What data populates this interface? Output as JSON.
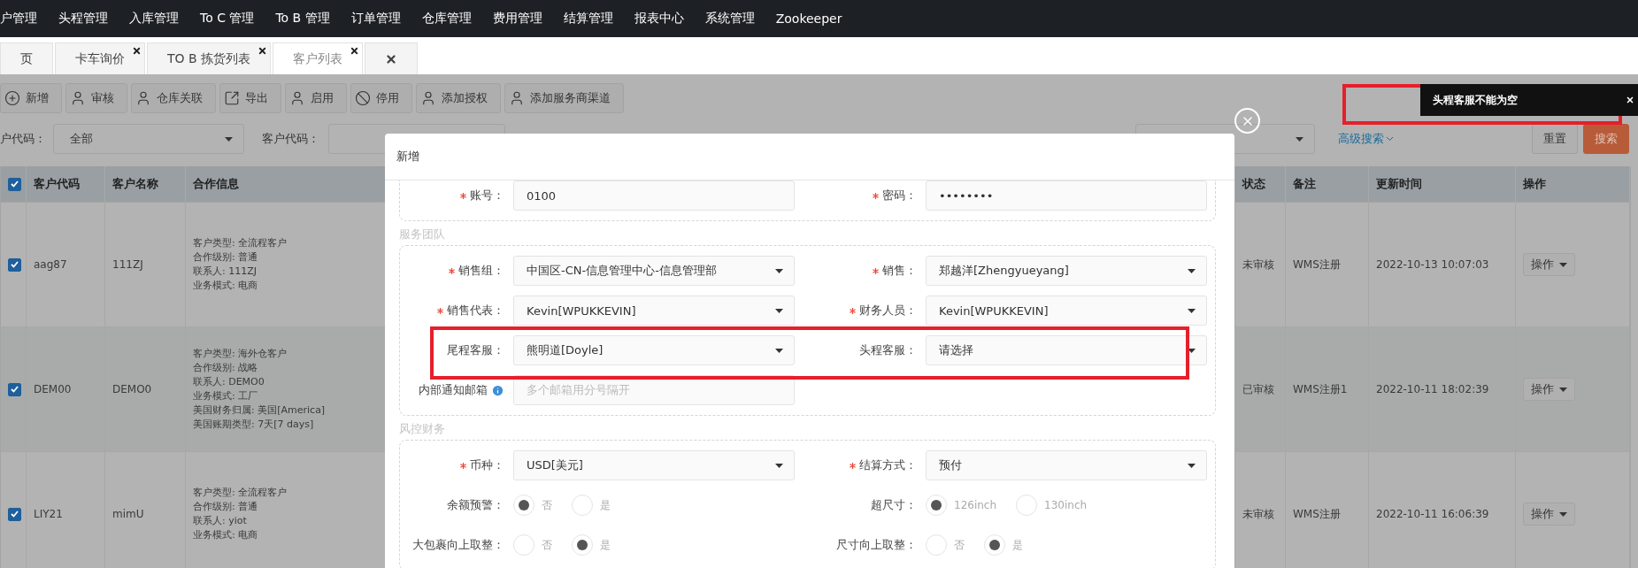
{
  "nav": {
    "items": [
      "户管理",
      "头程管理",
      "入库管理",
      "To C 管理",
      "To B 管理",
      "订单管理",
      "仓库管理",
      "费用管理",
      "结算管理",
      "报表中心",
      "系统管理",
      "Zookeeper"
    ]
  },
  "tabs": [
    {
      "kind": "text",
      "label": "页",
      "selected": false,
      "closable": false
    },
    {
      "kind": "text",
      "label": "卡车询价",
      "selected": false,
      "closable": true
    },
    {
      "kind": "text",
      "label": "TO B 拣货列表",
      "selected": false,
      "closable": true
    },
    {
      "kind": "text",
      "label": "客户列表",
      "selected": true,
      "closable": true
    },
    {
      "kind": "close",
      "selected": false,
      "closable": false
    }
  ],
  "toolbar": [
    {
      "kind": "plus",
      "label": "新增"
    },
    {
      "kind": "user",
      "label": "审核"
    },
    {
      "kind": "user",
      "label": "仓库关联"
    },
    {
      "kind": "export",
      "label": "导出"
    },
    {
      "kind": "user",
      "label": "启用"
    },
    {
      "kind": "ban",
      "label": "停用"
    },
    {
      "kind": "user",
      "label": "添加授权"
    },
    {
      "kind": "user",
      "label": "添加服务商渠道"
    }
  ],
  "filters": {
    "label_1": "户代码：",
    "select_1": "全部",
    "label_2": "客户代码：",
    "advanced": "高级搜索",
    "reset": "重置",
    "search": "搜索"
  },
  "table": {
    "header_checked": true,
    "columns": [
      "客户代码",
      "客户名称",
      "合作信息",
      "状态",
      "备注",
      "更新时间",
      "操作"
    ],
    "rows": [
      {
        "checked": true,
        "code": "aag87",
        "name": "111ZJ",
        "info": [
          "客户类型: 全流程客户",
          "合作级别: 普通",
          "联系人: 111ZJ",
          "业务模式: 电商"
        ],
        "status": "未审核",
        "remark": "WMS注册",
        "updated": "2022-10-13 10:07:03",
        "action": "操作"
      },
      {
        "checked": true,
        "code": "DEM00",
        "name": "DEMO0",
        "info": [
          "客户类型: 海外仓客户",
          "合作级别: 战略",
          "联系人: DEMO0",
          "业务模式: 工厂",
          "美国财务归属: 美国[America]",
          "美国账期类型: 7天[7 days]"
        ],
        "status": "已审核",
        "remark": "WMS注册1",
        "updated": "2022-10-11 18:02:39",
        "action": "操作"
      },
      {
        "checked": true,
        "code": "LIY21",
        "name": "mimU",
        "info": [
          "客户类型: 全流程客户",
          "合作级别: 普通",
          "联系人: yiot",
          "业务模式: 电商"
        ],
        "status": "未审核",
        "remark": "WMS注册",
        "updated": "2022-10-11 16:06:39",
        "action": "操作"
      }
    ]
  },
  "modal": {
    "title": "新增",
    "sections": [
      {
        "fields": [
          {
            "label": "账号：",
            "required": true,
            "kind": "input",
            "value": "0100"
          },
          {
            "label": "密码：",
            "required": true,
            "kind": "input",
            "value": "••••••••"
          }
        ]
      },
      {
        "legend": "服务团队",
        "fields": [
          {
            "label": "销售组：",
            "required": true,
            "kind": "select",
            "value": "中国区-CN-信息管理中心-信息管理部"
          },
          {
            "label": "销售：",
            "required": true,
            "kind": "select",
            "value": "郑越洋[Zhengyueyang]"
          },
          {
            "label": "销售代表：",
            "required": true,
            "kind": "select",
            "value": "Kevin[WPUKKEVIN]"
          },
          {
            "label": "财务人员：",
            "required": true,
            "kind": "select",
            "value": "Kevin[WPUKKEVIN]"
          },
          {
            "label": "尾程客服：",
            "required": false,
            "kind": "select",
            "value": "熊明道[Doyle]"
          },
          {
            "label": "头程客服：",
            "required": false,
            "kind": "select",
            "value": "请选择"
          },
          {
            "label": "内部通知邮箱",
            "required": false,
            "kind": "input",
            "info": true,
            "placeholder": "多个邮箱用分号隔开"
          }
        ]
      },
      {
        "legend": "风控财务",
        "fields": [
          {
            "label": "币种：",
            "required": true,
            "kind": "select",
            "value": "USD[美元]"
          },
          {
            "label": "结算方式：",
            "required": true,
            "kind": "select",
            "value": "预付"
          },
          {
            "label": "余额预警：",
            "required": false,
            "kind": "radio",
            "options": [
              {
                "label": "否",
                "selected": true
              },
              {
                "label": "是",
                "selected": false
              }
            ]
          },
          {
            "label": "超尺寸：",
            "required": false,
            "kind": "radio",
            "options": [
              {
                "label": "126inch",
                "selected": true
              },
              {
                "label": "130inch",
                "selected": false
              }
            ]
          },
          {
            "label": "大包裹向上取整：",
            "required": false,
            "kind": "radio",
            "options": [
              {
                "label": "否",
                "selected": false
              },
              {
                "label": "是",
                "selected": true
              }
            ]
          },
          {
            "label": "尺寸向上取整：",
            "required": false,
            "kind": "radio",
            "options": [
              {
                "label": "否",
                "selected": false
              },
              {
                "label": "是",
                "selected": true
              }
            ]
          }
        ]
      }
    ]
  },
  "toast": {
    "message": "头程客服不能为空"
  }
}
